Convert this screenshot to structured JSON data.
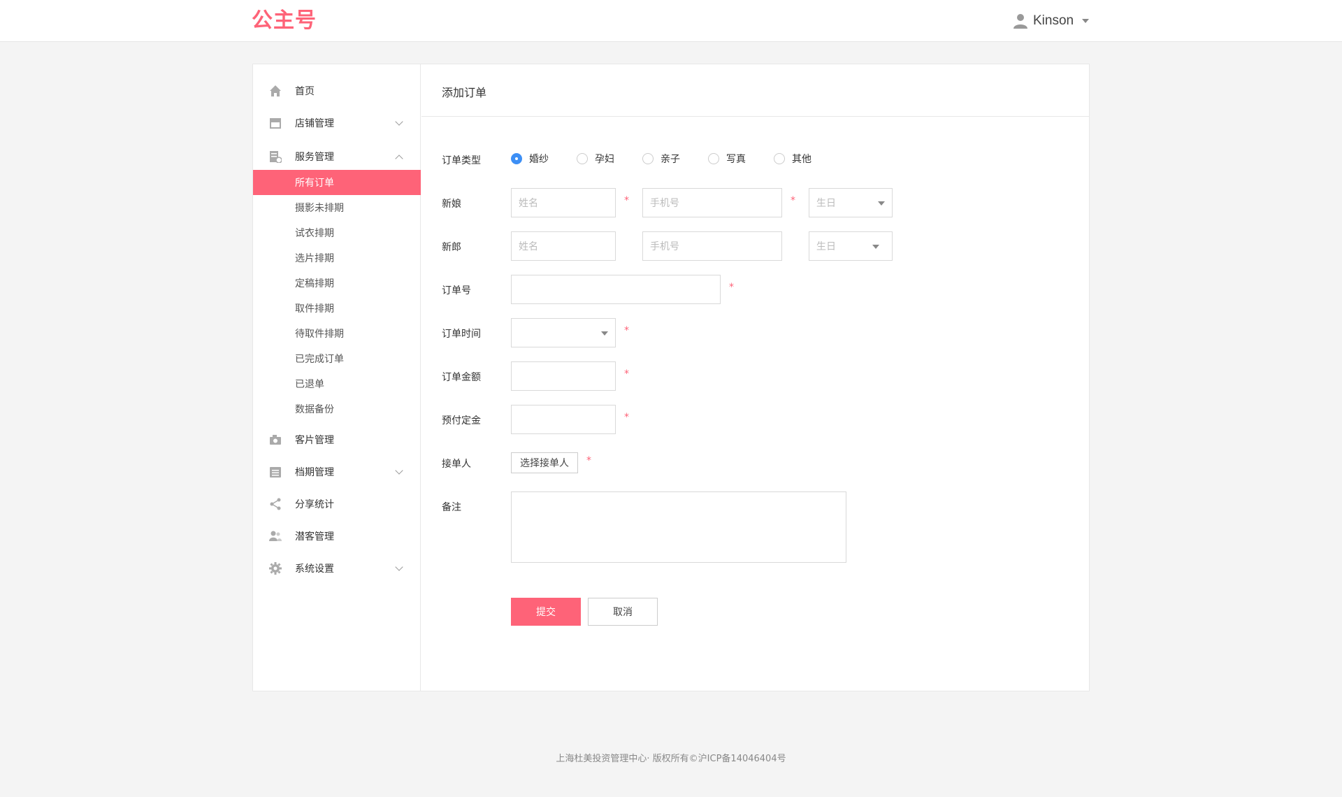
{
  "header": {
    "logo_text": "公主号",
    "user_name": "Kinson"
  },
  "sidebar": {
    "items": [
      {
        "label": "首页",
        "icon": "home-icon"
      },
      {
        "label": "店铺管理",
        "icon": "store-icon"
      },
      {
        "label": "服务管理",
        "icon": "service-icon"
      },
      {
        "label": "客片管理",
        "icon": "camera-icon"
      },
      {
        "label": "档期管理",
        "icon": "schedule-icon"
      },
      {
        "label": "分享统计",
        "icon": "share-icon"
      },
      {
        "label": "潜客管理",
        "icon": "users-icon"
      },
      {
        "label": "系统设置",
        "icon": "gear-icon"
      }
    ],
    "sub_items": [
      {
        "label": "所有订单",
        "active": true
      },
      {
        "label": "摄影未排期"
      },
      {
        "label": "试衣排期"
      },
      {
        "label": "选片排期"
      },
      {
        "label": "定稿排期"
      },
      {
        "label": "取件排期"
      },
      {
        "label": "待取件排期"
      },
      {
        "label": "已完成订单"
      },
      {
        "label": "已退单"
      },
      {
        "label": "数据备份"
      }
    ]
  },
  "form": {
    "title": "添加订单",
    "order_type": {
      "label": "订单类型",
      "options": [
        "婚纱",
        "孕妇",
        "亲子",
        "写真",
        "其他"
      ],
      "selected": "婚纱"
    },
    "bride": {
      "label": "新娘",
      "name_placeholder": "姓名",
      "phone_placeholder": "手机号",
      "birthday_placeholder": "生日"
    },
    "groom": {
      "label": "新郎",
      "name_placeholder": "姓名",
      "phone_placeholder": "手机号",
      "birthday_placeholder": "生日"
    },
    "order_no": {
      "label": "订单号"
    },
    "order_time": {
      "label": "订单时间"
    },
    "order_amount": {
      "label": "订单金额"
    },
    "deposit": {
      "label": "预付定金"
    },
    "receiver": {
      "label": "接单人",
      "button": "选择接单人"
    },
    "remark": {
      "label": "备注"
    },
    "required_mark": "*",
    "submit": "提交",
    "cancel": "取消"
  },
  "footer": {
    "text": "上海杜美投资管理中心· 版权所有©沪ICP备14046404号"
  },
  "colors": {
    "accent": "#fe6378",
    "radio_checked": "#3d8ff5"
  }
}
